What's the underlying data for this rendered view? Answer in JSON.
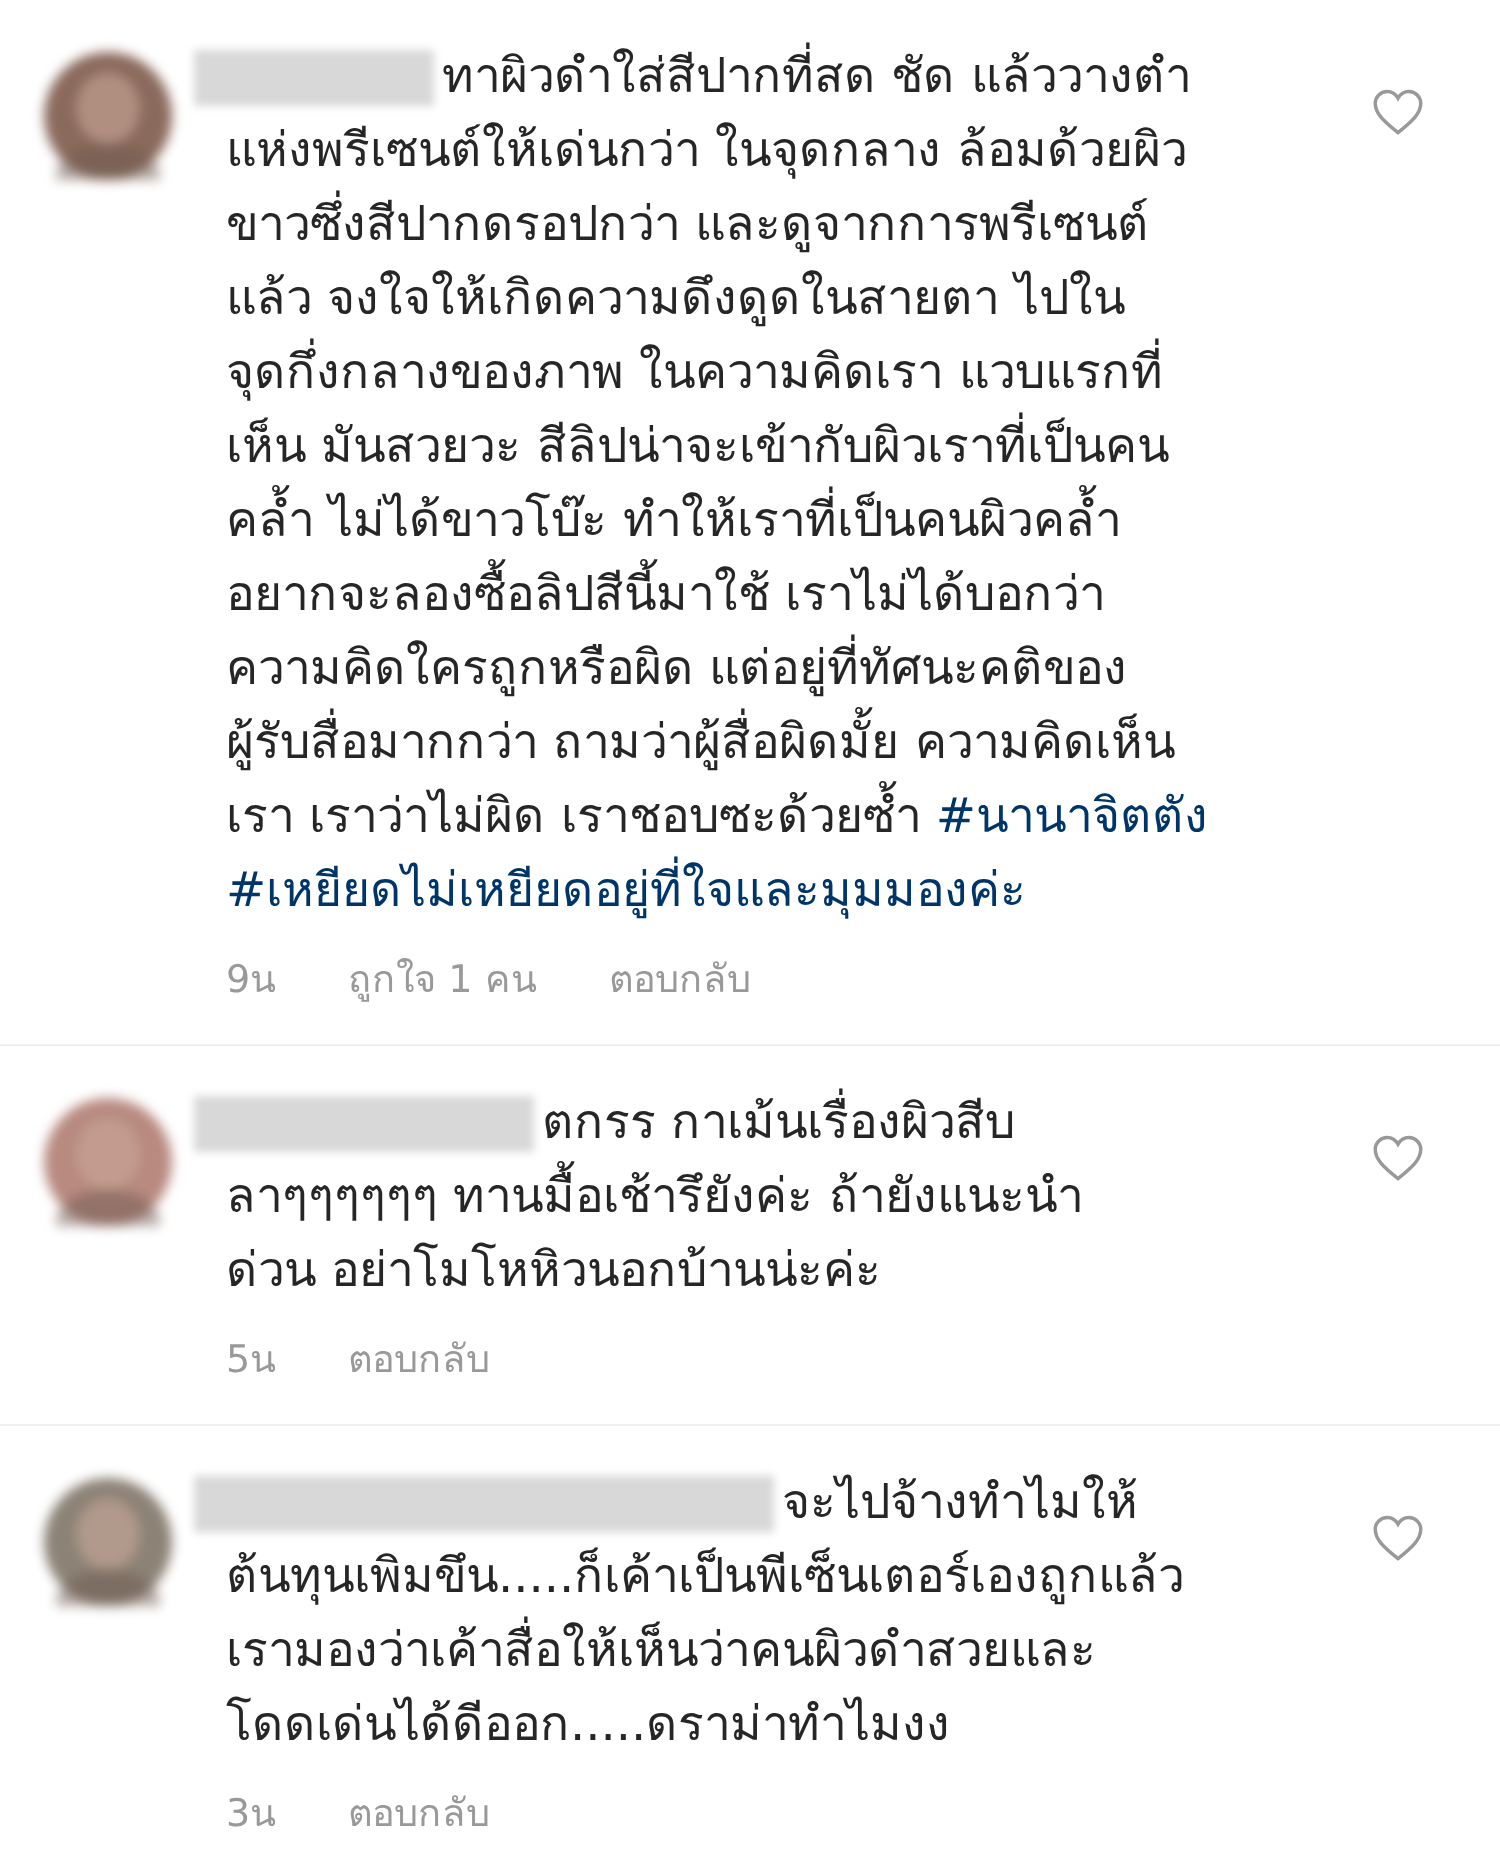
{
  "comments": [
    {
      "lines": [
        [
          {
            "kind": "text",
            "text": "ทาผิวดำใส่สีปากที่สด ชัด แล้ววางตำ"
          }
        ],
        [
          {
            "kind": "text",
            "text": "แห่งพรีเซนต์ให้เด่นกว่า ในจุดกลาง ล้อมด้วยผิว"
          }
        ],
        [
          {
            "kind": "text",
            "text": "ขาวซึ่งสีปากดรอปกว่า และดูจากการพรีเซนต์"
          }
        ],
        [
          {
            "kind": "text",
            "text": "แล้ว จงใจให้เกิดความดึงดูดในสายตา ไปใน"
          }
        ],
        [
          {
            "kind": "text",
            "text": "จุดกึ่งกลางของภาพ  ในความคิดเรา แวบแรกที่"
          }
        ],
        [
          {
            "kind": "text",
            "text": "เห็น มันสวยวะ สีลิปน่าจะเข้ากับผิวเราที่เป็นคน"
          }
        ],
        [
          {
            "kind": "text",
            "text": "คล้ำ ไม่ได้ขาวโบ๊ะ  ทำให้เราที่เป็นคนผิวคล้ำ"
          }
        ],
        [
          {
            "kind": "text",
            "text": "อยากจะลองซื้อลิปสีนี้มาใช้ เราไม่ได้บอกว่า"
          }
        ],
        [
          {
            "kind": "text",
            "text": "ความคิดใครถูกหรือผิด แต่อยู่ที่ทัศนะคติของ"
          }
        ],
        [
          {
            "kind": "text",
            "text": "ผู้รับสื่อมากกว่า ถามว่าผู้สื่อผิดมั้ย ความคิดเห็น"
          }
        ],
        [
          {
            "kind": "text",
            "text": "เรา เราว่าไม่ผิด เราชอบซะด้วยซ้ำ "
          },
          {
            "kind": "hashtag",
            "text": "#นานาจิตตัง"
          }
        ],
        [
          {
            "kind": "hashtag",
            "text": "#เหยียดไม่เหยียดอยู่ที่ใจและมุมมองค่ะ"
          }
        ]
      ],
      "time": "9น",
      "likes": "ถูกใจ 1 คน",
      "reply": "ตอบกลับ",
      "liked": false
    },
    {
      "lines": [
        [
          {
            "kind": "text",
            "text": "ตกรร  กาเม้นเรื่องผิวสีบ"
          }
        ],
        [
          {
            "kind": "text",
            "text": "ลาๆๆๆๆๆๆ  ทานมื้อเช้ารึยังค่ะ  ถ้ายังแนะนำ"
          }
        ],
        [
          {
            "kind": "text",
            "text": "ด่วน  อย่าโมโหหิวนอกบ้านน่ะค่ะ"
          }
        ]
      ],
      "time": "5น",
      "reply": "ตอบกลับ",
      "liked": false
    },
    {
      "lines": [
        [
          {
            "kind": "text",
            "text": "จะไปจ้างทำไมให้"
          }
        ],
        [
          {
            "kind": "text",
            "text": "ต้นทุนเพิมขึน.....ก็เค้าเป็นพีเซ็นเตอร์เองถูกแล้ว"
          }
        ],
        [
          {
            "kind": "text",
            "text": "เรามองว่าเค้าสื่อให้เห็นว่าคนผิวดำสวยและ"
          }
        ],
        [
          {
            "kind": "text",
            "text": "โดดเด่นได้ดีออก.....ดราม่าทำไมงง"
          }
        ]
      ],
      "time": "3น",
      "reply": "ตอบกลับ",
      "liked": false
    }
  ]
}
